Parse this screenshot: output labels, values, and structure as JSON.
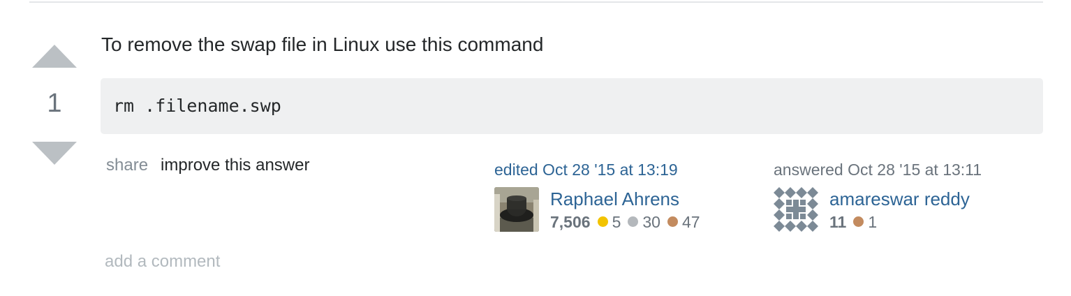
{
  "vote": {
    "count": "1",
    "up_icon": "triangle-up",
    "down_icon": "triangle-down"
  },
  "answer": {
    "text": "To remove the swap file in Linux use this command",
    "code": "rm .filename.swp"
  },
  "post_menu": {
    "share_label": "share",
    "improve_label": "improve this answer"
  },
  "editor": {
    "action_time": "edited Oct 28 '15 at 13:19",
    "name": "Raphael Ahrens",
    "reputation": "7,506",
    "gold_badges": "5",
    "silver_badges": "30",
    "bronze_badges": "47",
    "avatar_icon": "photo-avatar"
  },
  "author": {
    "action_time": "answered Oct 28 '15 at 13:11",
    "name": "amareswar reddy",
    "reputation": "11",
    "bronze_badges": "1",
    "avatar_icon": "identicon-avatar"
  },
  "comments": {
    "add_label": "add a comment"
  },
  "colors": {
    "link": "#2d6495",
    "muted": "#6a737c",
    "code_bg": "#eff0f1",
    "vote_arrow": "#bbc0c4",
    "gold": "#f2c300",
    "silver": "#b4b8bc",
    "bronze": "#c38b5f"
  }
}
